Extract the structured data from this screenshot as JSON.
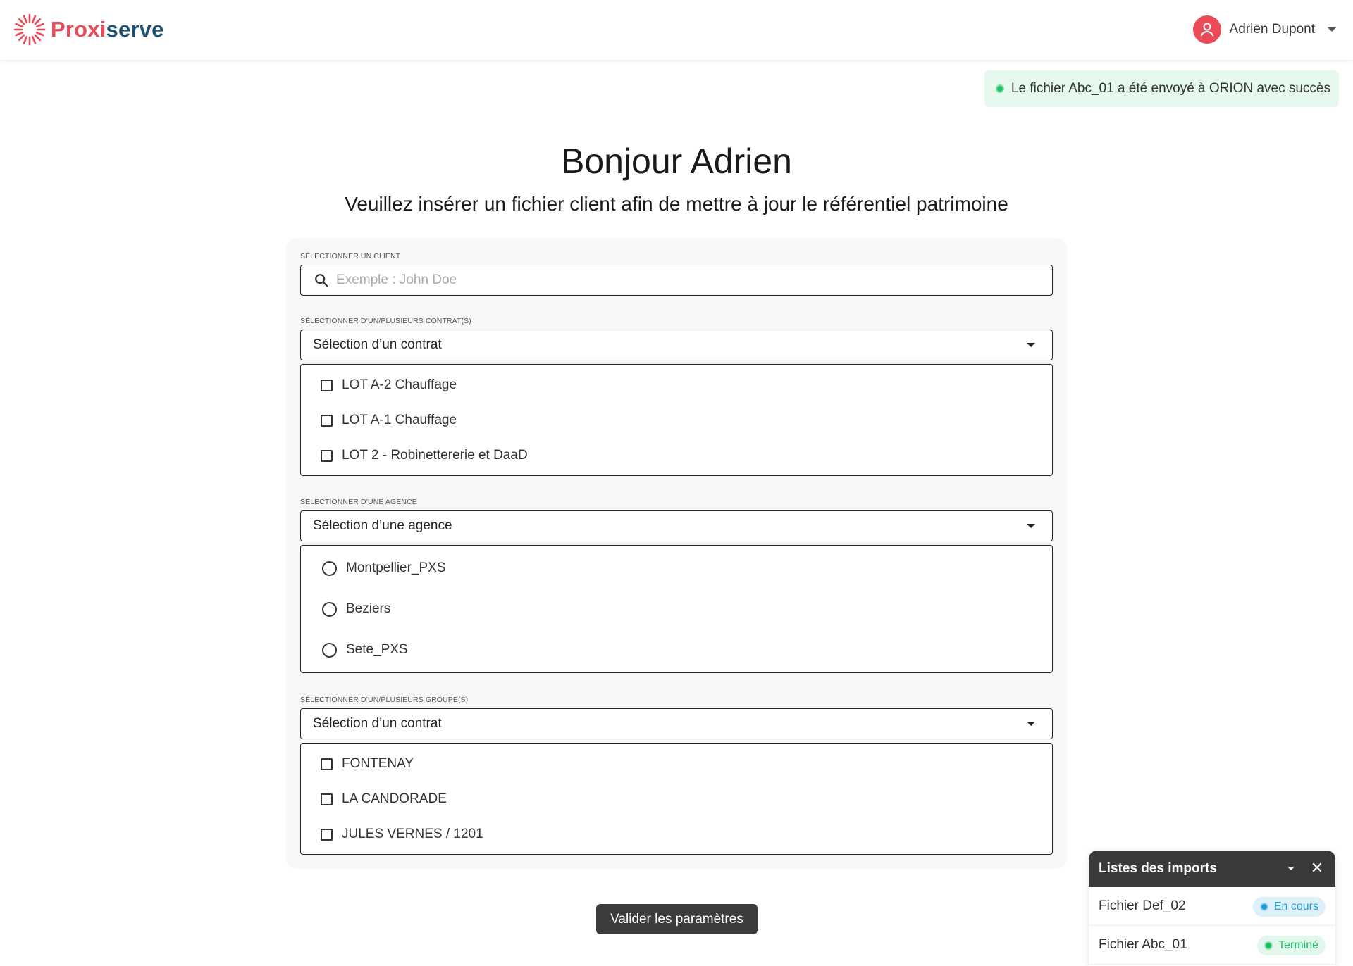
{
  "header": {
    "logo_part1": "Proxi",
    "logo_part2": "serve",
    "user_name": "Adrien Dupont",
    "colors": {
      "brand_red": "#e84c5b",
      "brand_blue": "#1f4f6e"
    }
  },
  "toast": {
    "message": "Le fichier Abc_01 a été envoyé à ORION avec succès",
    "status_color": "#1fc36b"
  },
  "main": {
    "title": "Bonjour Adrien",
    "subtitle": "Veuillez insérer un fichier client afin de mettre à jour le référentiel patrimoine"
  },
  "form": {
    "client": {
      "label": "Sélectionner un client",
      "placeholder": "Exemple : John Doe",
      "icon": "search-icon"
    },
    "contracts": {
      "label": "Sélectionner d’un/plusieurs contrat(s)",
      "selected": "Sélection d’un contrat",
      "options": [
        "LOT A-2 Chauffage",
        "LOT A-1 Chauffage",
        "LOT 2 -  Robinettererie et DaaD"
      ]
    },
    "agency": {
      "label": "Sélectionner d’une agence",
      "selected": "Sélection d’une agence",
      "options": [
        "Montpellier_PXS",
        "Beziers",
        "Sete_PXS"
      ]
    },
    "groups": {
      "label": "Sélectionner d’un/plusieurs groupe(s)",
      "selected": "Sélection d’un contrat",
      "options": [
        "FONTENAY",
        "LA CANDORADE",
        "JULES VERNES / 1201"
      ]
    },
    "submit_label": "Valider les paramètres"
  },
  "imports_panel": {
    "title": "Listes des imports",
    "items": [
      {
        "name": "Fichier Def_02",
        "status": "En cours",
        "status_color": "#1f9bd7"
      },
      {
        "name": "Fichier Abc_01",
        "status": "Terminé",
        "status_color": "#1fbf64"
      }
    ]
  }
}
